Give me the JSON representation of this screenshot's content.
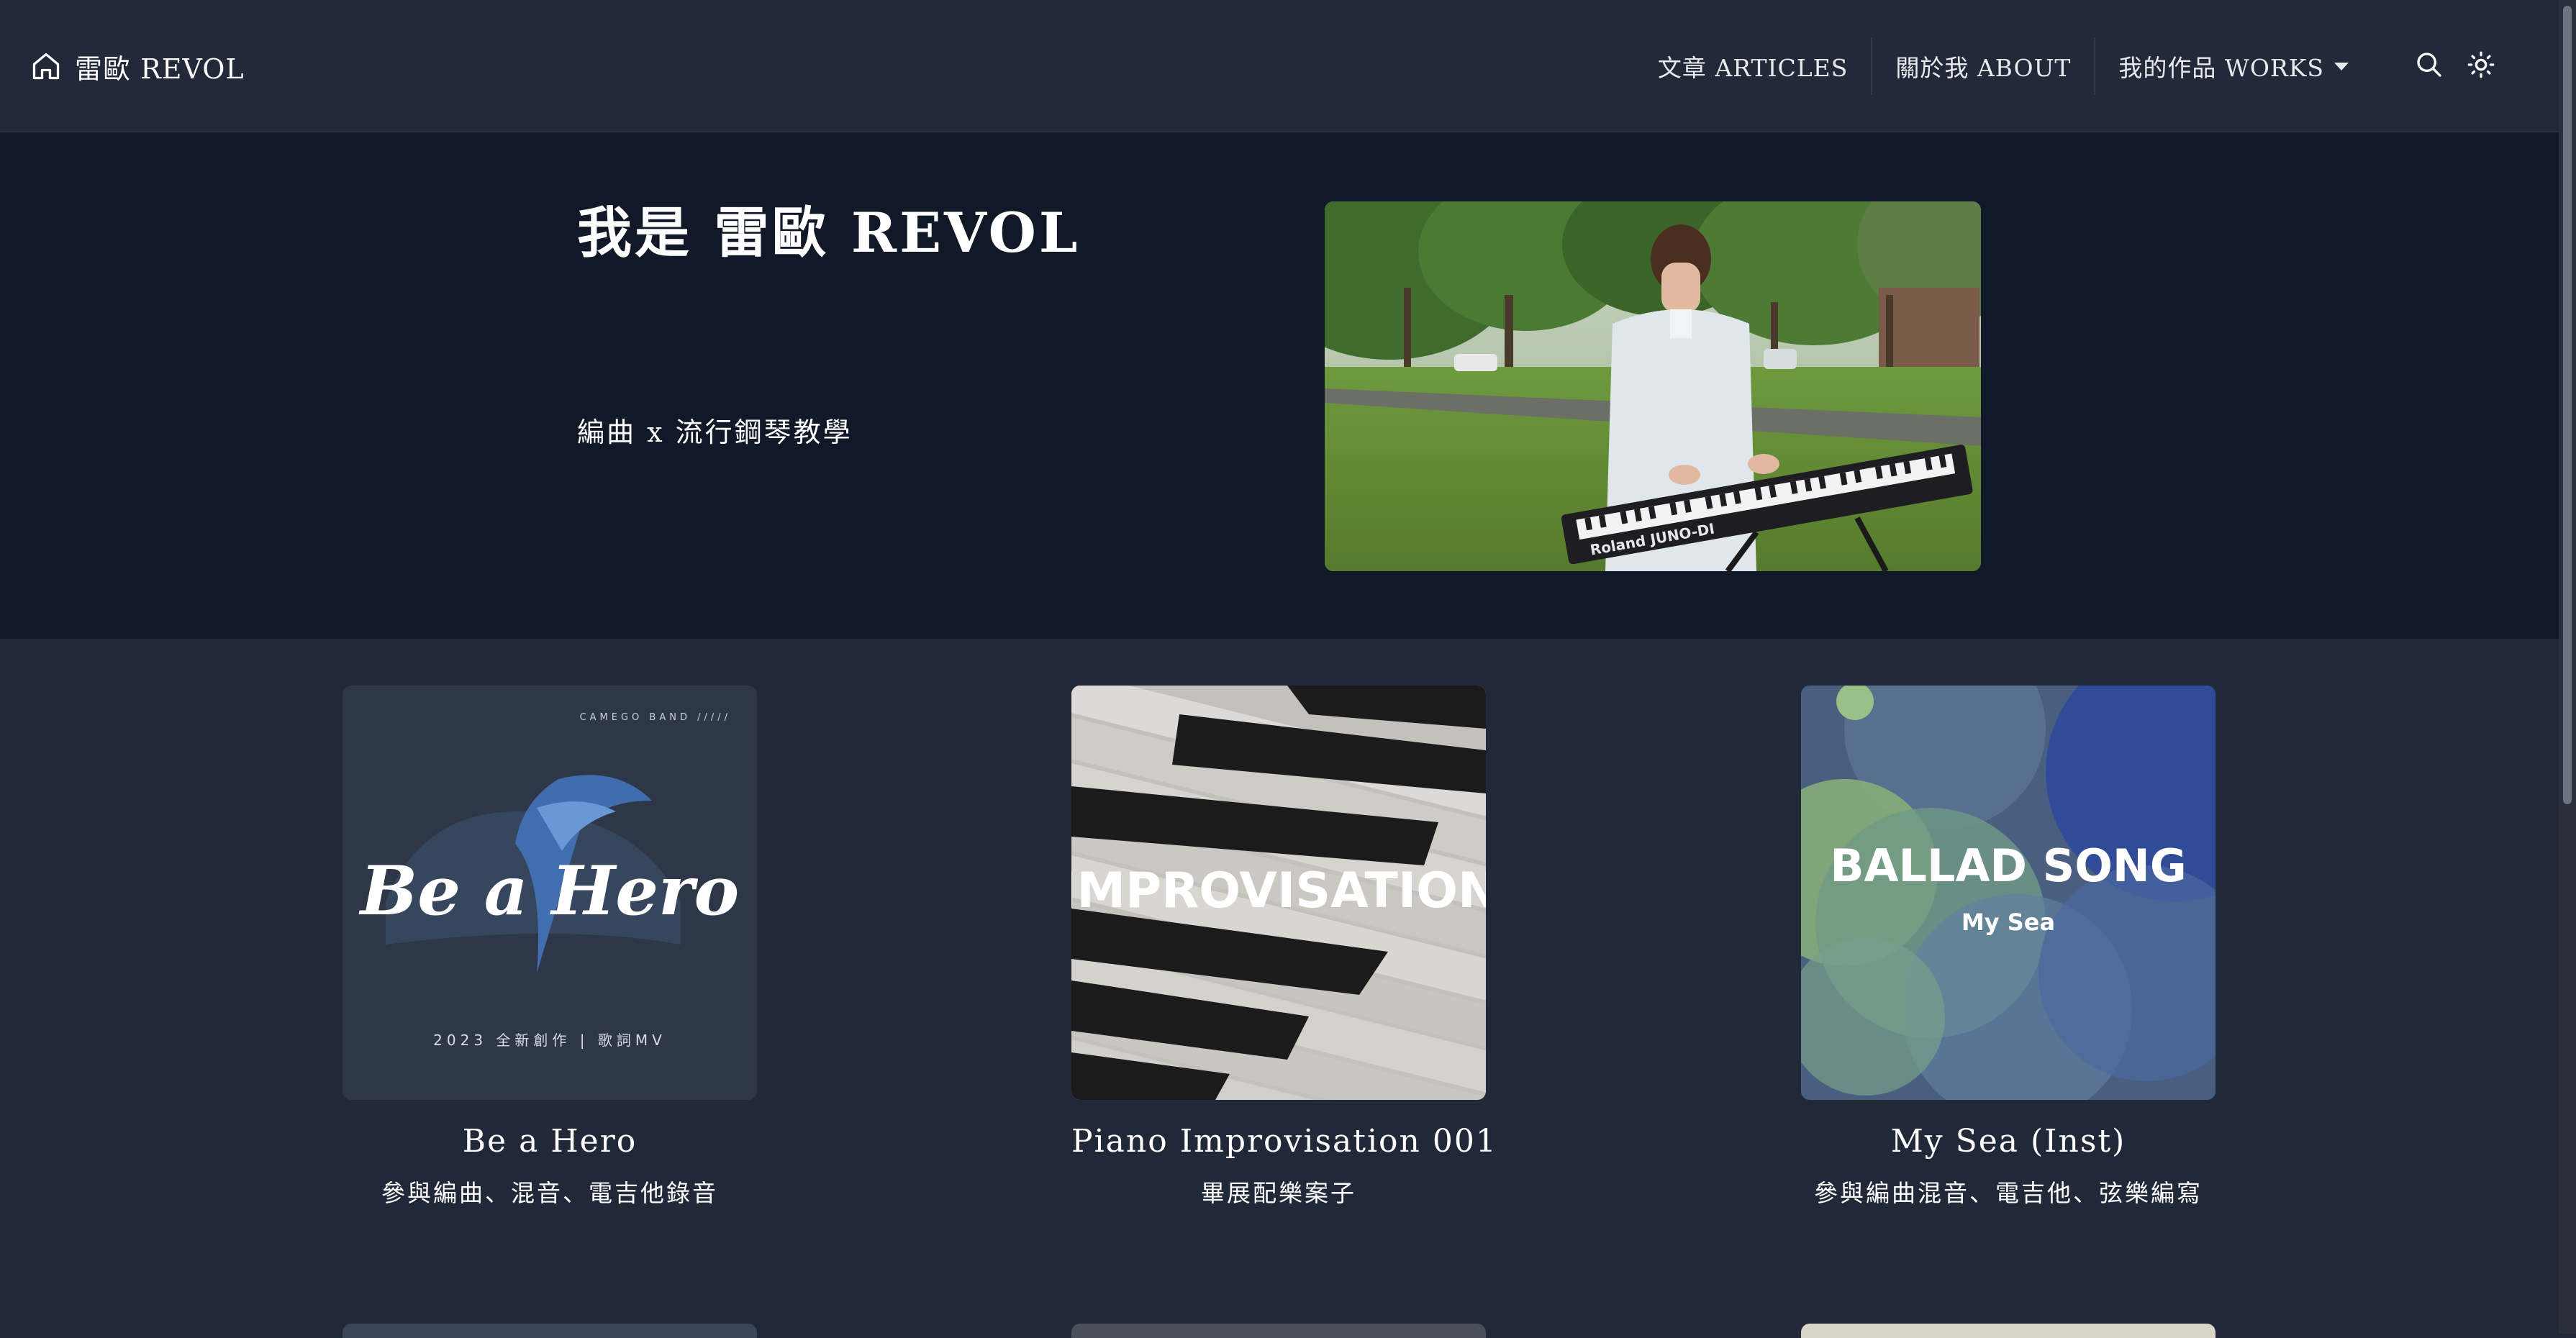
{
  "navbar": {
    "brand": "雷歐 REVOL",
    "links": [
      {
        "label": "文章 ARTICLES"
      },
      {
        "label": "關於我 ABOUT"
      },
      {
        "label": "我的作品 WORKS"
      }
    ]
  },
  "hero": {
    "title": "我是 雷歐 REVOL",
    "subtitle": "編曲 x 流行鋼琴教學",
    "photo_keyboard_text": "Roland JUNO-DI"
  },
  "works": [
    {
      "title": "Be a Hero",
      "description": "參與編曲、混音、電吉他錄音",
      "cover_band": "CAMEGO BAND /////",
      "cover_title": "Be a Hero",
      "cover_caption": "2023 全新創作 | 歌詞MV"
    },
    {
      "title": "Piano Improvisation 001",
      "description": "畢展配樂案子",
      "cover_title": "IMPROVISATION"
    },
    {
      "title": "My Sea (Inst)",
      "description": "參與編曲混音、電吉他、弦樂編寫",
      "cover_title": "BALLAD SONG",
      "cover_subtitle": "My Sea"
    }
  ],
  "colors": {
    "page_bg": "#212838",
    "hero_bg": "#111827",
    "text": "#ffffff"
  }
}
